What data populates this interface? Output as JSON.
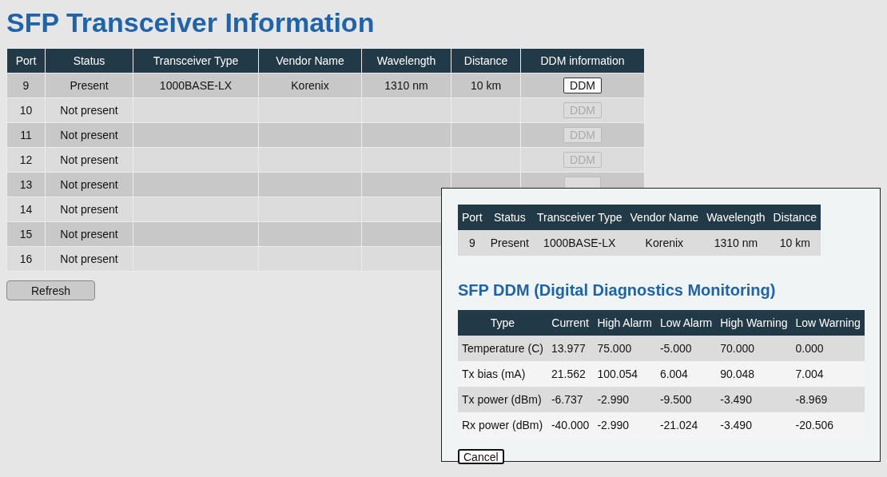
{
  "title": "SFP Transceiver Information",
  "table": {
    "columns": [
      "Port",
      "Status",
      "Transceiver Type",
      "Vendor Name",
      "Wavelength",
      "Distance",
      "DDM information"
    ],
    "rows": [
      {
        "port": "9",
        "status": "Present",
        "type": "1000BASE-LX",
        "vendor": "Korenix",
        "wavelength": "1310 nm",
        "distance": "10 km",
        "ddm_button": {
          "label": "DDM",
          "disabled": false
        }
      },
      {
        "port": "10",
        "status": "Not present",
        "ddm_button": {
          "label": "DDM",
          "disabled": true
        }
      },
      {
        "port": "11",
        "status": "Not present",
        "ddm_button": {
          "label": "DDM",
          "disabled": true
        }
      },
      {
        "port": "12",
        "status": "Not present",
        "ddm_button": {
          "label": "DDM",
          "disabled": true
        }
      },
      {
        "port": "13",
        "status": "Not present",
        "ddm_button": {
          "disabled": true
        }
      },
      {
        "port": "14",
        "status": "Not present"
      },
      {
        "port": "15",
        "status": "Not present"
      },
      {
        "port": "16",
        "status": "Not present"
      }
    ]
  },
  "refresh_button": "Refresh",
  "dialog": {
    "info_table": {
      "columns": [
        "Port",
        "Status",
        "Transceiver Type",
        "Vendor Name",
        "Wavelength",
        "Distance"
      ],
      "rows": [
        [
          "9",
          "Present",
          "1000BASE-LX",
          "Korenix",
          "1310 nm",
          "10 km"
        ]
      ]
    },
    "heading": "SFP DDM (Digital Diagnostics Monitoring)",
    "ddm_table": {
      "columns": [
        "Type",
        "Current",
        "High Alarm",
        "Low Alarm",
        "High Warning",
        "Low Warning"
      ],
      "rows": [
        [
          "Temperature (C)",
          "13.977",
          "75.000",
          "-5.000",
          "70.000",
          "0.000"
        ],
        [
          "Tx bias (mA)",
          "21.562",
          "100.054",
          "6.004",
          "90.048",
          "7.004"
        ],
        [
          "Tx power (dBm)",
          "-6.737",
          "-2.990",
          "-9.500",
          "-3.490",
          "-8.969"
        ],
        [
          "Rx power (dBm)",
          "-40.000",
          "-2.990",
          "-21.024",
          "-3.490",
          "-20.506"
        ]
      ]
    },
    "cancel_button": "Cancel"
  }
}
